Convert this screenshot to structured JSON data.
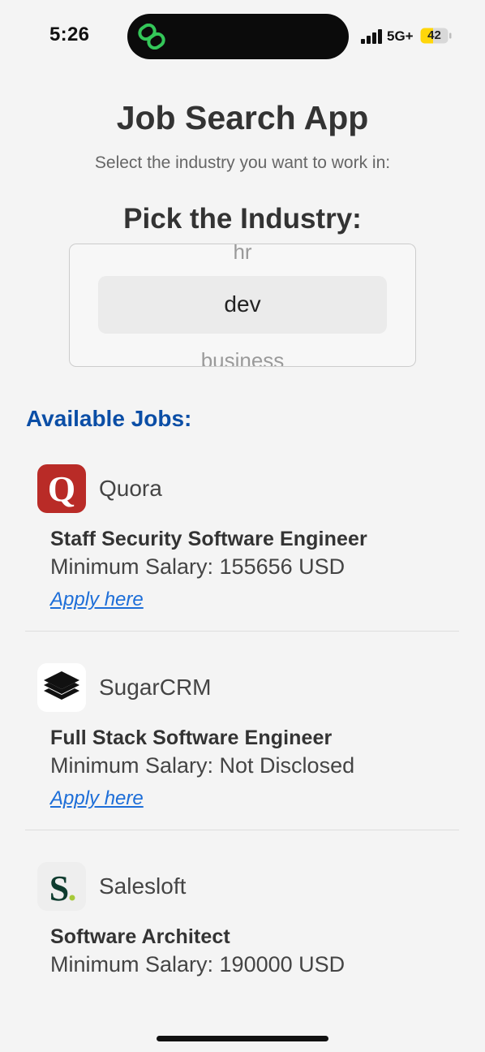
{
  "status_bar": {
    "time": "5:26",
    "network": "5G+",
    "battery": "42",
    "colors": {
      "island_icon": "#34c759",
      "battery_fill": "#ffd60a"
    },
    "icons": [
      "link-icon",
      "signal-icon",
      "battery-icon"
    ]
  },
  "header": {
    "title": "Job Search App",
    "subtitle": "Select the industry you want to work in:"
  },
  "picker": {
    "label": "Pick the Industry:",
    "option_above": "hr",
    "selected": "dev",
    "option_below": "business"
  },
  "jobs": {
    "heading": "Available Jobs:",
    "heading_color": "#0b4ea6",
    "items": [
      {
        "company": "Quora",
        "logo_icon": "quora-logo-icon",
        "logo_color": "#b92b27",
        "title": "Staff Security Software Engineer",
        "salary": "Minimum Salary: 155656 USD",
        "apply": "Apply here"
      },
      {
        "company": "SugarCRM",
        "logo_icon": "sugarcrm-logo-icon",
        "logo_color": "#111111",
        "title": "Full Stack Software Engineer",
        "salary": "Minimum Salary: Not Disclosed",
        "apply": "Apply here"
      },
      {
        "company": "Salesloft",
        "logo_icon": "salesloft-logo-icon",
        "logo_color": "#0d3b2e",
        "title": "Software Architect",
        "salary": "Minimum Salary: 190000 USD"
      }
    ]
  }
}
